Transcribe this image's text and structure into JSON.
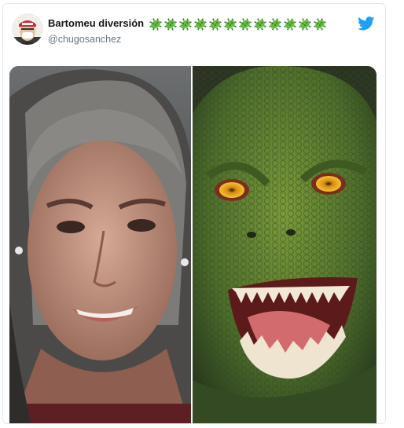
{
  "tweet": {
    "display_name": "Bartomeu diversión",
    "name_emoji": "virus-icon",
    "name_emoji_count": 12,
    "handle": "@chugosanchez",
    "brand_color": "#1da1f2",
    "logo_icon": "twitter-bird-icon"
  },
  "media": {
    "images": [
      {
        "subject": "woman-portrait-photo"
      },
      {
        "subject": "lizard-creature-photo"
      }
    ]
  }
}
